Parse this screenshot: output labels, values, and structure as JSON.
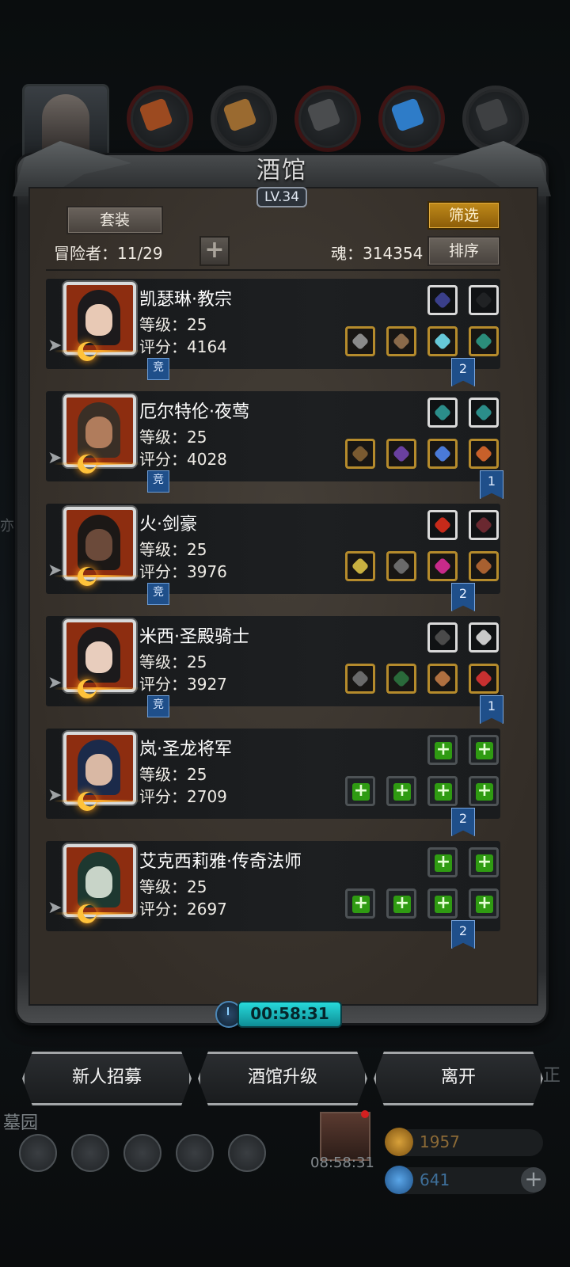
{
  "panel": {
    "title": "酒馆",
    "level": "LV.34",
    "set_button": "套装",
    "filter_button": "筛选",
    "sort_button": "排序",
    "adventurers_label": "冒险者：11/29",
    "soul_label": "魂：314354",
    "add_icon": "plus-icon"
  },
  "heroes": [
    {
      "name": "凯瑟琳·教宗",
      "level": "等级：25",
      "score": "评分：4164",
      "tag": "竞",
      "flag": "2",
      "portrait_color": "#1c1a1c",
      "skin": "#e8c9b5"
    },
    {
      "name": "厄尔特伦·夜莺",
      "level": "等级：25",
      "score": "评分：4028",
      "tag": "竞",
      "flag": "1",
      "portrait_color": "#3a2f26",
      "skin": "#b07c5c"
    },
    {
      "name": "火·剑豪",
      "level": "等级：25",
      "score": "评分：3976",
      "tag": "竞",
      "flag": "2",
      "portrait_color": "#1c1816",
      "skin": "#6b4a3a"
    },
    {
      "name": "米西·圣殿骑士",
      "level": "等级：25",
      "score": "评分：3927",
      "tag": "竞",
      "flag": "1",
      "portrait_color": "#1c1a1c",
      "skin": "#e8cdbd"
    },
    {
      "name": "岚·圣龙将军",
      "level": "等级：25",
      "score": "评分：2709",
      "tag": "",
      "flag": "2",
      "portrait_color": "#1b2a4a",
      "skin": "#d9b8a4"
    },
    {
      "name": "艾克西莉雅·传奇法师",
      "level": "等级：25",
      "score": "评分：2697",
      "tag": "",
      "flag": "2",
      "portrait_color": "#1d3830",
      "skin": "#c8d4c8"
    }
  ],
  "timer": "00:58:31",
  "actions": {
    "recruit": "新人招募",
    "upgrade": "酒馆升级",
    "leave": "离开"
  },
  "hud": {
    "area_label": "墓园",
    "gift_timer": "08:58:31",
    "gold": "1957",
    "gems": "641",
    "side_left": "亦",
    "side_right": "正"
  }
}
